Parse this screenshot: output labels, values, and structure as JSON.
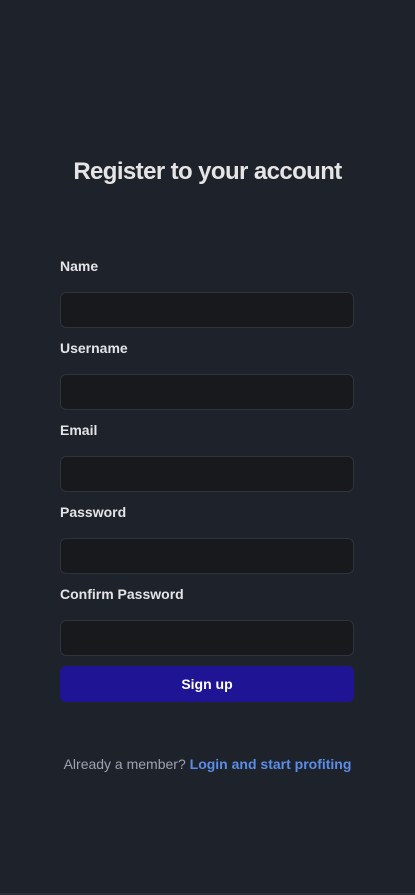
{
  "title": "Register to your account",
  "form": {
    "name_label": "Name",
    "name_value": "",
    "username_label": "Username",
    "username_value": "",
    "email_label": "Email",
    "email_value": "",
    "password_label": "Password",
    "password_value": "",
    "confirm_password_label": "Confirm Password",
    "confirm_password_value": "",
    "submit_label": "Sign up"
  },
  "footer": {
    "text": "Already a member?",
    "link_label": "Login and start profiting"
  },
  "colors": {
    "background": "#1e222b",
    "input_background": "#18191d",
    "button_background": "#1e1494",
    "link": "#5b8de6"
  }
}
